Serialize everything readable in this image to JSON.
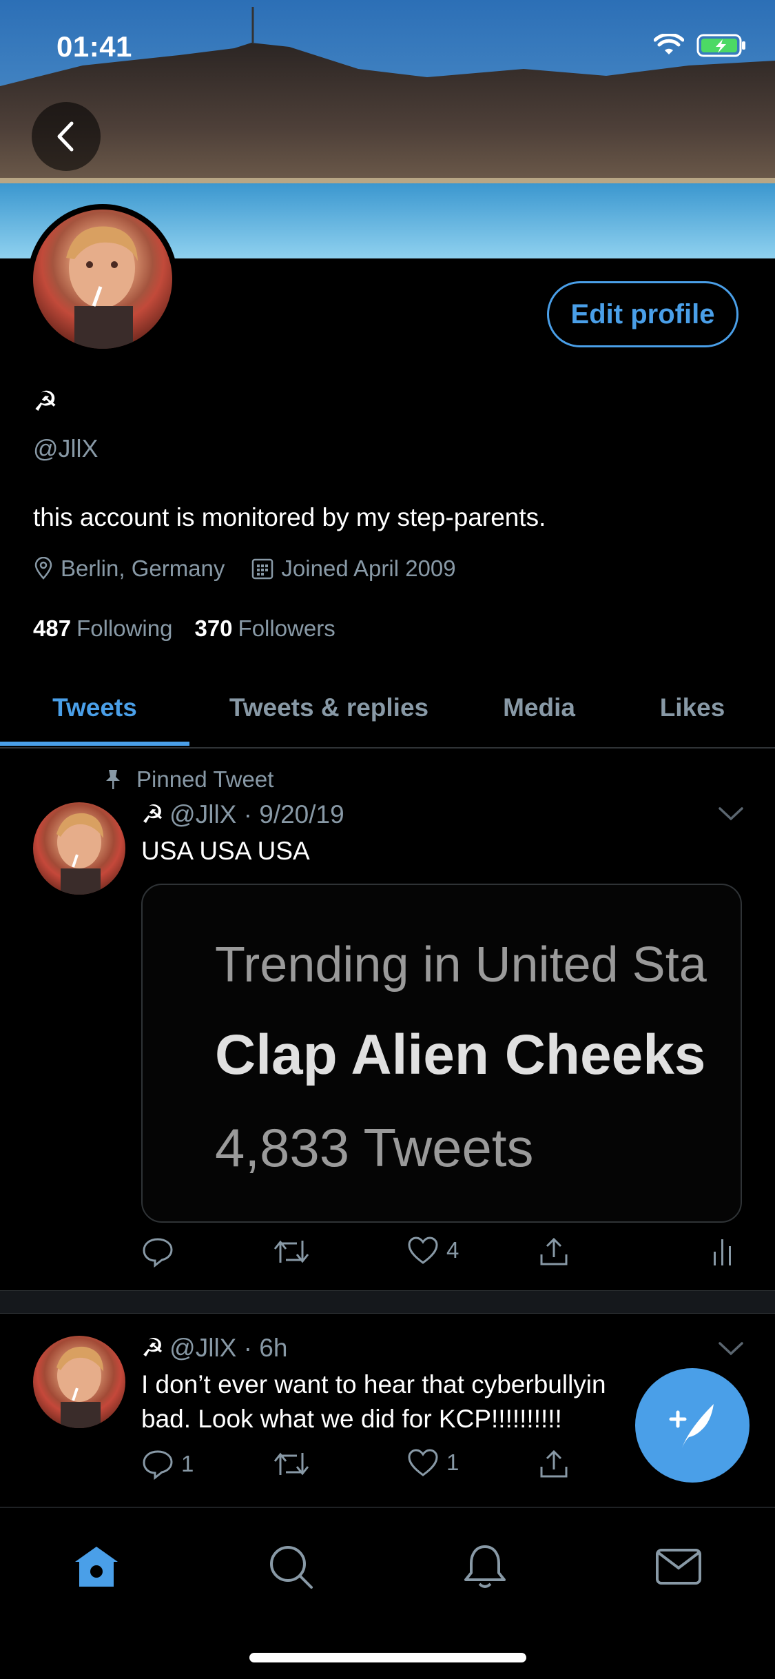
{
  "status_bar": {
    "time": "01:41"
  },
  "profile": {
    "display_name": "☭",
    "handle": "@JllX",
    "bio": "this account is monitored by my step-parents.",
    "location": "Berlin, Germany",
    "joined": "Joined April 2009",
    "following_count": "487",
    "following_label": "Following",
    "followers_count": "370",
    "followers_label": "Followers",
    "edit_button": "Edit profile"
  },
  "tabs": [
    {
      "label": "Tweets",
      "active": true
    },
    {
      "label": "Tweets & replies",
      "active": false
    },
    {
      "label": "Media",
      "active": false
    },
    {
      "label": "Likes",
      "active": false
    }
  ],
  "tweets": [
    {
      "pinned_label": "Pinned Tweet",
      "name_symbol": "☭",
      "handle": "@JllX",
      "separator": "·",
      "date": "9/20/19",
      "text": "USA USA USA",
      "card": {
        "line1": "Trending in United Sta",
        "line2": "Clap Alien Cheeks",
        "line3": "4,833 Tweets"
      },
      "reply_count": "",
      "retweet_count": "",
      "like_count": "4"
    },
    {
      "name_symbol": "☭",
      "handle": "@JllX",
      "separator": "·",
      "date": "6h",
      "text_line1": "I don’t ever want to hear that cyberbullyin",
      "text_line2": "bad. Look what we did for KCP!!!!!!!!!!",
      "reply_count": "1",
      "retweet_count": "",
      "like_count": "1"
    }
  ],
  "colors": {
    "accent": "#4a9fe8",
    "secondary_text": "#8899a6",
    "background": "#000000"
  },
  "icons": [
    "back-arrow-icon",
    "wifi-icon",
    "battery-icon",
    "location-pin-icon",
    "calendar-icon",
    "pin-icon",
    "chevron-down-icon",
    "reply-icon",
    "retweet-icon",
    "like-icon",
    "share-icon",
    "analytics-icon",
    "compose-icon",
    "home-icon",
    "search-icon",
    "notifications-icon",
    "messages-icon"
  ]
}
